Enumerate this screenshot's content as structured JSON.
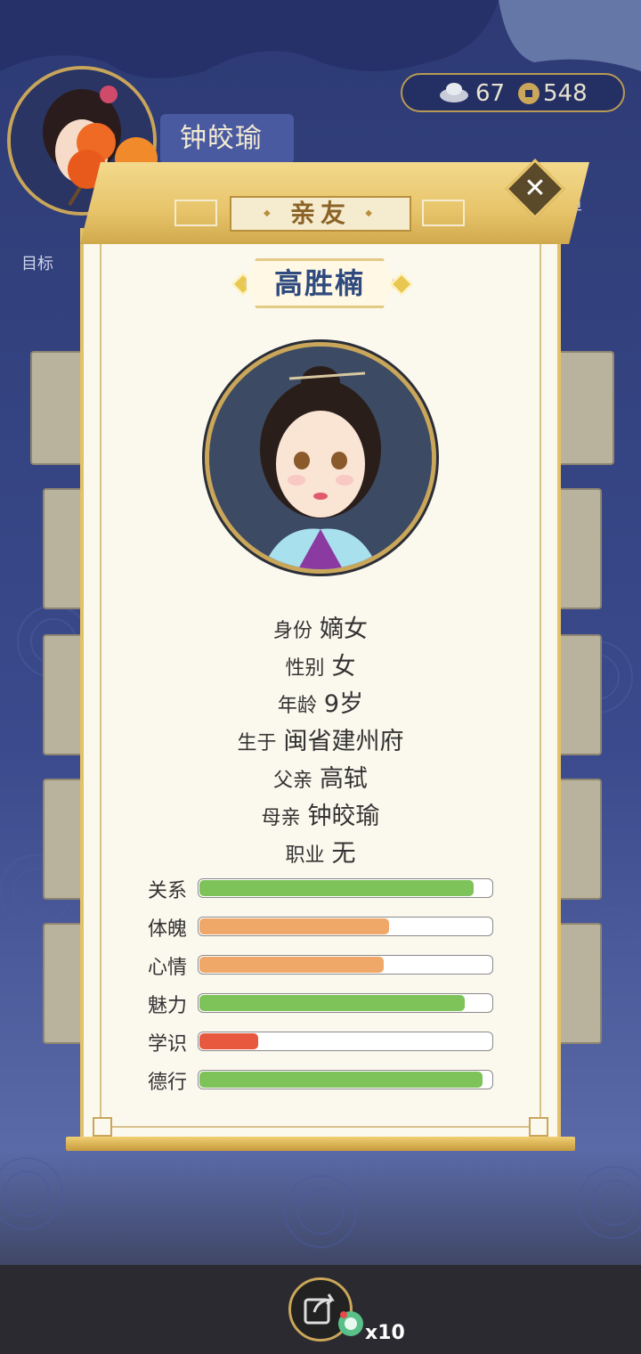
{
  "hud": {
    "player_name": "钟皎瑜",
    "silver": "67",
    "coins": "548",
    "target_label": "目标",
    "list_label": "单"
  },
  "modal": {
    "title": "亲友",
    "close_symbol": "✕",
    "npc_name": "高胜楠",
    "info": [
      {
        "key": "身份",
        "value": "嫡女"
      },
      {
        "key": "性别",
        "value": "女"
      },
      {
        "key": "年龄",
        "value": "9岁"
      },
      {
        "key": "生于",
        "value": "闽省建州府"
      },
      {
        "key": "父亲",
        "value": "高轼"
      },
      {
        "key": "母亲",
        "value": "钟皎瑜"
      },
      {
        "key": "职业",
        "value": "无"
      }
    ],
    "stats": [
      {
        "label": "关系",
        "fraction": 0.94,
        "color": "#7ec35a"
      },
      {
        "label": "体魄",
        "fraction": 0.65,
        "color": "#f0a868"
      },
      {
        "label": "心情",
        "fraction": 0.63,
        "color": "#f0a868"
      },
      {
        "label": "魅力",
        "fraction": 0.91,
        "color": "#7ec35a"
      },
      {
        "label": "学识",
        "fraction": 0.2,
        "color": "#e8583e"
      },
      {
        "label": "德行",
        "fraction": 0.97,
        "color": "#7ec35a"
      }
    ]
  },
  "bottom": {
    "share_count": "x10"
  }
}
